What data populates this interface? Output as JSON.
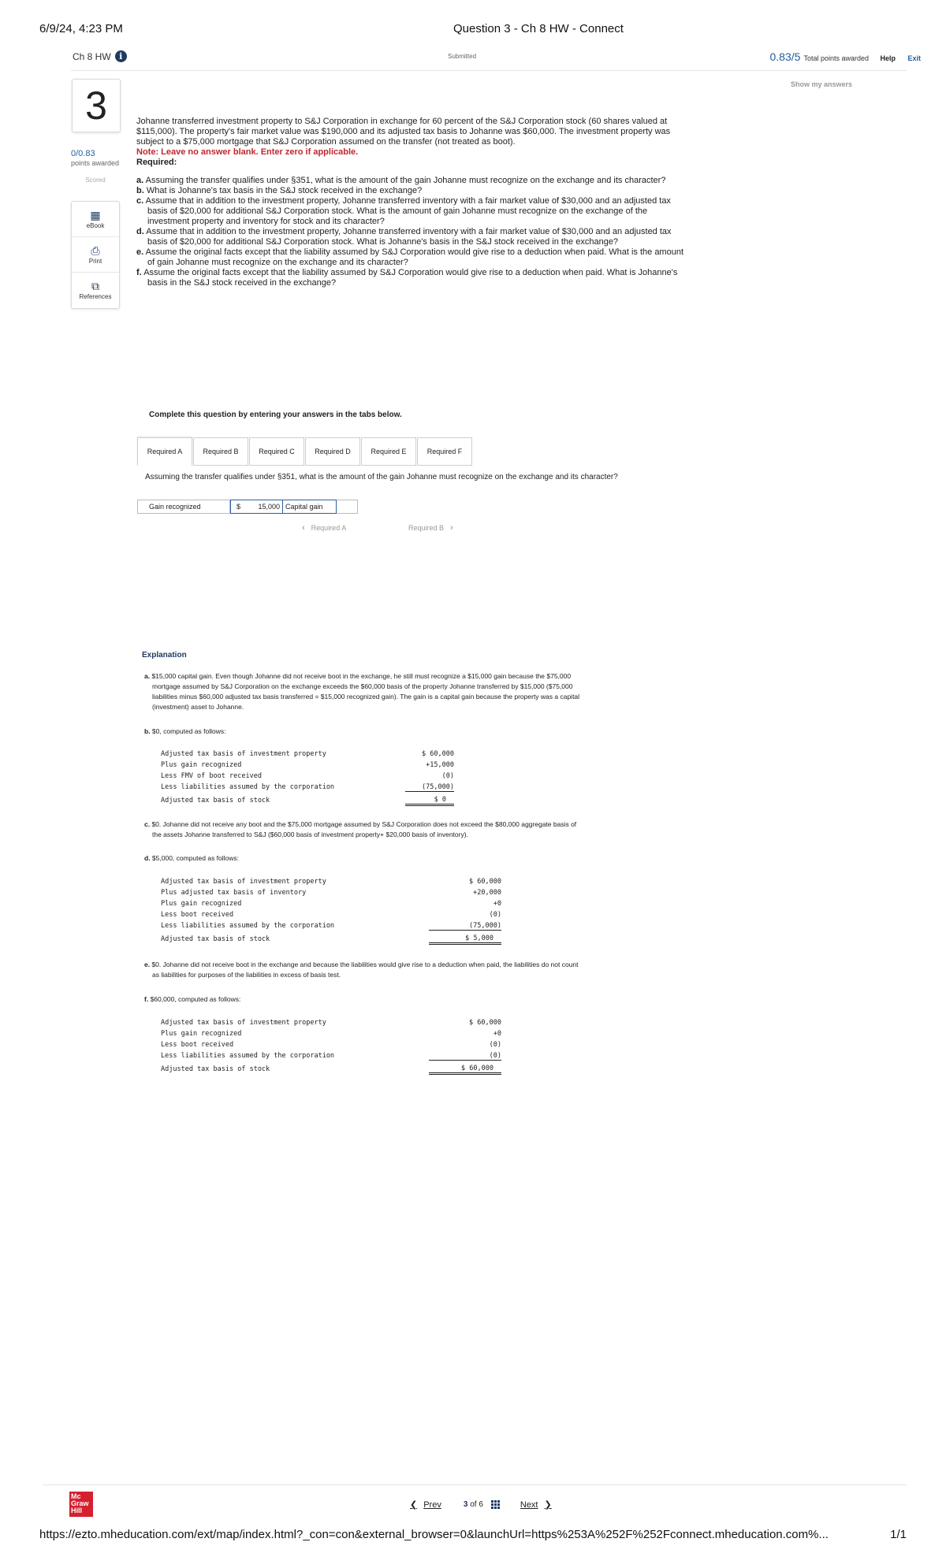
{
  "print_header": {
    "datetime": "6/9/24, 4:23 PM",
    "title": "Question 3 - Ch 8 HW - Connect"
  },
  "topbar": {
    "hw_title": "Ch 8 HW",
    "status": "Submitted",
    "points_score": "0.83/5",
    "points_label": "Total points awarded",
    "help": "Help",
    "exit": "Exit",
    "show_answers": "Show my answers"
  },
  "sidebar": {
    "question_number": "3",
    "score": "0/0.83",
    "score_label": "points awarded",
    "scored": "Scored",
    "tools": [
      {
        "label": "eBook",
        "icon": "book-icon"
      },
      {
        "label": "Print",
        "icon": "printer-icon"
      },
      {
        "label": "References",
        "icon": "copy-icon"
      }
    ]
  },
  "question": {
    "stem": "Johanne transferred investment property to S&J Corporation in exchange for 60 percent of the S&J Corporation stock (60 shares valued at $115,000). The property's fair market value was $190,000 and its adjusted tax basis to Johanne was $60,000. The investment property was subject to a $75,000 mortgage that S&J Corporation assumed on the transfer (not treated as boot).",
    "note": "Note: Leave no answer blank. Enter zero if applicable.",
    "required_heading": "Required:",
    "parts": [
      {
        "letter": "a.",
        "text": "Assuming the transfer qualifies under §351, what is the amount of the gain Johanne must recognize on the exchange and its character?"
      },
      {
        "letter": "b.",
        "text": "What is Johanne's tax basis in the S&J stock received in the exchange?"
      },
      {
        "letter": "c.",
        "text": "Assume that in addition to the investment property, Johanne transferred inventory with a fair market value of $30,000 and an adjusted tax basis of $20,000 for additional S&J Corporation stock. What is the amount of gain Johanne must recognize on the exchange of the investment property and inventory for stock and its character?"
      },
      {
        "letter": "d.",
        "text": "Assume that in addition to the investment property, Johanne transferred inventory with a fair market value of $30,000 and an adjusted tax basis of $20,000 for additional S&J Corporation stock. What is Johanne's basis in the S&J stock received in the exchange?"
      },
      {
        "letter": "e.",
        "text": "Assume the original facts except that the liability assumed by S&J Corporation would give rise to a deduction when paid. What is the amount of gain Johanne must recognize on the exchange and its character?"
      },
      {
        "letter": "f.",
        "text": "Assume the original facts except that the liability assumed by S&J Corporation would give rise to a deduction when paid. What is Johanne's basis in the S&J stock received in the exchange?"
      }
    ]
  },
  "answer_area": {
    "instruction": "Complete this question by entering your answers in the tabs below.",
    "tabs": [
      "Required A",
      "Required B",
      "Required C",
      "Required D",
      "Required E",
      "Required F"
    ],
    "active_tab": 0,
    "prompt": "Assuming the transfer qualifies under §351, what is the amount of the gain Johanne must recognize on the exchange and its character?",
    "row_label": "Gain recognized",
    "currency": "$",
    "amount": "15,000",
    "character": "Capital gain",
    "prev_label": "Required A",
    "next_label": "Required B"
  },
  "explanation": {
    "heading": "Explanation",
    "a": {
      "letter": "a.",
      "line1": " $15,000 capital gain. Even though Johanne did not receive boot in the exchange, he still must recognize a $15,000 gain because the $75,000",
      "line2": "mortgage assumed by S&J Corporation on the exchange exceeds the $60,000 basis of the property Johanne transferred by $15,000 ($75,000",
      "line3": "liabilities minus $60,000 adjusted tax basis transferred = $15,000 recognized gain). The gain is a capital gain because the property was a capital",
      "line4": "(investment) asset to Johanne."
    },
    "b": {
      "letter": "b.",
      "text": " $0, computed as follows:",
      "rows": [
        {
          "label": "Adjusted tax basis of investment property",
          "value": "$ 60,000"
        },
        {
          "label": "Plus gain recognized",
          "value": "+15,000"
        },
        {
          "label": "Less FMV of boot received",
          "value": "(0)"
        },
        {
          "label": "Less liabilities assumed by the corporation",
          "value": "(75,000)"
        }
      ],
      "total_label": "Adjusted tax basis of stock",
      "total_value": "$ 0"
    },
    "c": {
      "letter": "c.",
      "line1": " $0. Johanne did not receive any boot and the $75,000 mortgage assumed by S&J Corporation does not exceed the $80,000 aggregate basis of",
      "line2": "the assets Johanne transferred to S&J ($60,000 basis of investment property+ $20,000 basis of inventory)."
    },
    "d": {
      "letter": "d.",
      "text": " $5,000, computed as follows:",
      "rows": [
        {
          "label": "Adjusted tax basis of investment property",
          "value": "$ 60,000"
        },
        {
          "label": "Plus adjusted tax basis of inventory",
          "value": "+20,000"
        },
        {
          "label": "Plus gain recognized",
          "value": "+0"
        },
        {
          "label": "Less boot received",
          "value": "(0)"
        },
        {
          "label": "Less liabilities assumed by the corporation",
          "value": "(75,000)"
        }
      ],
      "total_label": "Adjusted tax basis of stock",
      "total_value": "$ 5,000"
    },
    "e": {
      "letter": "e.",
      "line1": " $0. Johanne did not receive boot in the exchange and because the liabilities would give rise to a deduction when paid, the liabilities do not count",
      "line2": "as liabilities for purposes of the liabilities in excess of basis test."
    },
    "f": {
      "letter": "f.",
      "text": " $60,000, computed as follows:",
      "rows": [
        {
          "label": "Adjusted tax basis of investment property",
          "value": "$ 60,000"
        },
        {
          "label": "Plus gain recognized",
          "value": "+0"
        },
        {
          "label": "Less boot received",
          "value": "(0)"
        },
        {
          "label": "Less liabilities assumed by the corporation",
          "value": "(0)"
        }
      ],
      "total_label": "Adjusted tax basis of stock",
      "total_value": "$ 60,000"
    }
  },
  "footer": {
    "logo_lines": [
      "Mc",
      "Graw",
      "Hill"
    ],
    "prev": "Prev",
    "current": "3",
    "of_label": "of",
    "total": "6",
    "next": "Next"
  },
  "print_footer": {
    "url": "https://ezto.mheducation.com/ext/map/index.html?_con=con&external_browser=0&launchUrl=https%253A%252F%252Fconnect.mheducation.com%...",
    "page": "1/1"
  }
}
